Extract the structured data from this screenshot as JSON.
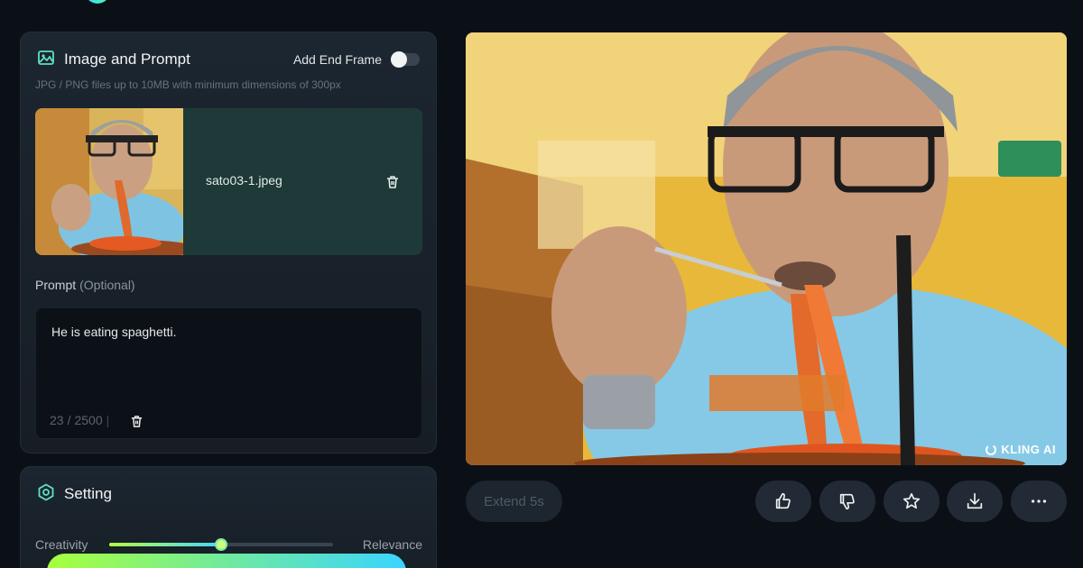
{
  "left_panel": {
    "title": "Image and Prompt",
    "end_frame_label": "Add End Frame",
    "end_frame_enabled": false,
    "hint": "JPG / PNG files up to 10MB with minimum dimensions of 300px",
    "upload": {
      "filename": "sato03-1.jpeg"
    },
    "prompt": {
      "label": "Prompt",
      "optional": "(Optional)",
      "value": "He is eating spaghetti.",
      "count": "23",
      "separator": "/",
      "max": "2500"
    }
  },
  "setting_panel": {
    "title": "Setting",
    "slider_left": "Creativity",
    "slider_right": "Relevance",
    "slider_value": 0.5
  },
  "preview": {
    "watermark": "KLING AI"
  },
  "actions": {
    "extend_label": "Extend 5s"
  },
  "colors": {
    "accent_green": "#a7ff3d",
    "accent_blue": "#3ad4ff",
    "icon_teal": "#5fe0c0"
  }
}
